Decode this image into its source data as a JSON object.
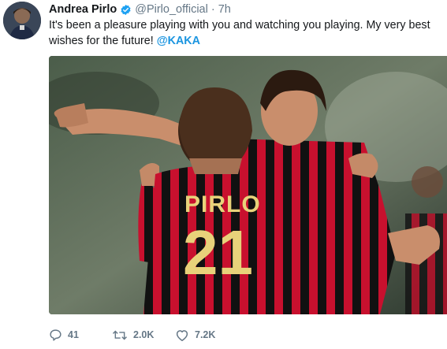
{
  "tweet": {
    "author_name": "Andrea Pirlo",
    "handle": "@Pirlo_official",
    "separator": "·",
    "time": "7h",
    "text_before_mention": "It's been a pleasure playing with you and watching you playing. My very best wishes for the future! ",
    "mention": "@KAKA",
    "media": {
      "jersey_name": "PIRLO",
      "jersey_number": "21"
    },
    "actions": {
      "reply_count": "41",
      "retweet_count": "2.0K",
      "like_count": "7.2K"
    }
  },
  "colors": {
    "mention": "#1b95e0",
    "secondary_text": "#657786",
    "verified": "#1da1f2",
    "jersey_red": "#c8102e",
    "jersey_black": "#111111",
    "jersey_number_gold": "#e8d27a"
  },
  "icons": {
    "verified": "verified-badge-icon",
    "reply": "reply-icon",
    "retweet": "retweet-icon",
    "like": "heart-icon"
  }
}
